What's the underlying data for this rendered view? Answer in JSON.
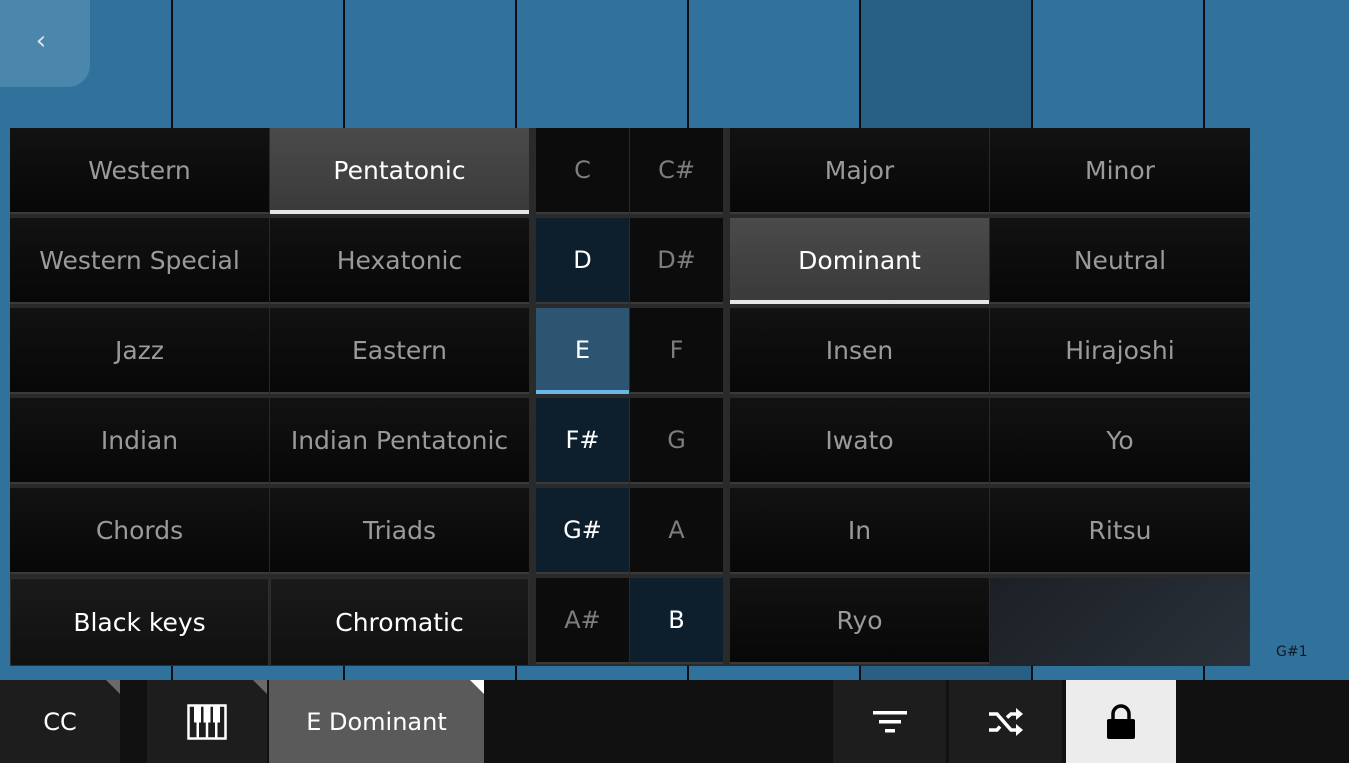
{
  "back_label": "‹",
  "pad_label": "G#1",
  "categories": [
    [
      "Western",
      "Pentatonic"
    ],
    [
      "Western Special",
      "Hexatonic"
    ],
    [
      "Jazz",
      "Eastern"
    ],
    [
      "Indian",
      "Indian Pentatonic"
    ],
    [
      "Chords",
      "Triads"
    ]
  ],
  "selected_category": "Pentatonic",
  "bottom_buttons": [
    "Black keys",
    "Chromatic"
  ],
  "notes": [
    [
      "C",
      "C#"
    ],
    [
      "D",
      "D#"
    ],
    [
      "E",
      "F"
    ],
    [
      "F#",
      "G"
    ],
    [
      "G#",
      "A"
    ],
    [
      "A#",
      "B"
    ]
  ],
  "root_note": "E",
  "scale_notes": [
    "E",
    "F#",
    "G#",
    "B",
    "D"
  ],
  "scales": [
    [
      "Major",
      "Minor"
    ],
    [
      "Dominant",
      "Neutral"
    ],
    [
      "Insen",
      "Hirajoshi"
    ],
    [
      "Iwato",
      "Yo"
    ],
    [
      "In",
      "Ritsu"
    ],
    [
      "Ryo",
      ""
    ]
  ],
  "selected_scale": "Dominant",
  "toolbar": {
    "cc_label": "CC",
    "keyboard_icon": "piano-keys-icon",
    "scale_label": "E Dominant",
    "filter_icon": "filter-icon",
    "shuffle_icon": "shuffle-icon",
    "lock_icon": "lock-icon"
  },
  "colors": {
    "pad": "#31729c",
    "root_highlight": "#68b8e6",
    "in_scale": "#0d1f2c"
  }
}
